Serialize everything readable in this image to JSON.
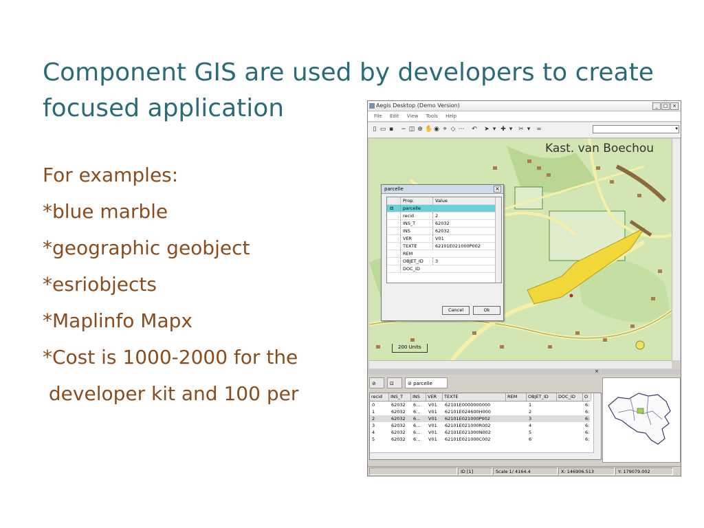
{
  "slide": {
    "title_lines": [
      "Component GIS are used by developers to create",
      "focused application"
    ],
    "bullets": [
      "For examples:",
      "*blue marble",
      "*geographic geobject",
      "*esriobjects",
      "*Maplinfo Mapx",
      "*Cost is 1000-2000 for the",
      " developer kit and 100 per"
    ]
  },
  "app": {
    "title": "Aegis Desktop (Demo Version)",
    "window_buttons": [
      "_",
      "□",
      "×"
    ],
    "menu": [
      "File",
      "Edit",
      "View",
      "Tools",
      "Help"
    ],
    "map": {
      "place_label": "Kast. van Boechou",
      "scale_text": "200 Units"
    },
    "dialog": {
      "title": "parcelle",
      "close": "×",
      "headers": [
        "Prop.",
        "Value"
      ],
      "rows": [
        {
          "expander": "⊟",
          "prop": "parcelle",
          "value": ""
        },
        {
          "expander": "",
          "prop": "recid",
          "value": "2"
        },
        {
          "expander": "",
          "prop": "INS_T",
          "value": "62032"
        },
        {
          "expander": "",
          "prop": "INS",
          "value": "62032"
        },
        {
          "expander": "",
          "prop": "VER",
          "value": "V01"
        },
        {
          "expander": "",
          "prop": "TEXTE",
          "value": "62101E021000P002"
        },
        {
          "expander": "",
          "prop": "REM",
          "value": ""
        },
        {
          "expander": "",
          "prop": "OBJET_ID",
          "value": "3"
        },
        {
          "expander": "",
          "prop": "DOC_ID",
          "value": ""
        }
      ],
      "cancel_label": "Cancel",
      "ok_label": "Ok"
    },
    "bottom": {
      "close": "×",
      "tab_label": "parcelle",
      "columns": [
        "recid",
        "INS_T",
        "INS",
        "VER",
        "TEXTE",
        "REM",
        "OBJET_ID",
        "DOC_ID",
        "O"
      ],
      "rows": [
        [
          "0",
          "62032",
          "6...",
          "V01",
          "62101E0000000000",
          "",
          "1",
          "",
          "6:"
        ],
        [
          "1",
          "62032",
          "6...",
          "V01",
          "62101E024600H000",
          "",
          "2",
          "",
          "6:"
        ],
        [
          "2",
          "62032",
          "6...",
          "V01",
          "62101E021000P002",
          "",
          "3",
          "",
          "6:"
        ],
        [
          "3",
          "62032",
          "6...",
          "V01",
          "62101E021000R002",
          "",
          "4",
          "",
          "6:"
        ],
        [
          "4",
          "62032",
          "6...",
          "V01",
          "62101E021000N002",
          "",
          "5",
          "",
          "6:"
        ],
        [
          "5",
          "62032",
          "6...",
          "V01",
          "62101E021000C002",
          "",
          "6",
          "",
          "6:"
        ]
      ]
    },
    "status": {
      "id": "ID [1]",
      "scale": "Scale 1/ 4164.4",
      "x": "X: 146906.513",
      "y": "Y: 179079.002"
    }
  }
}
